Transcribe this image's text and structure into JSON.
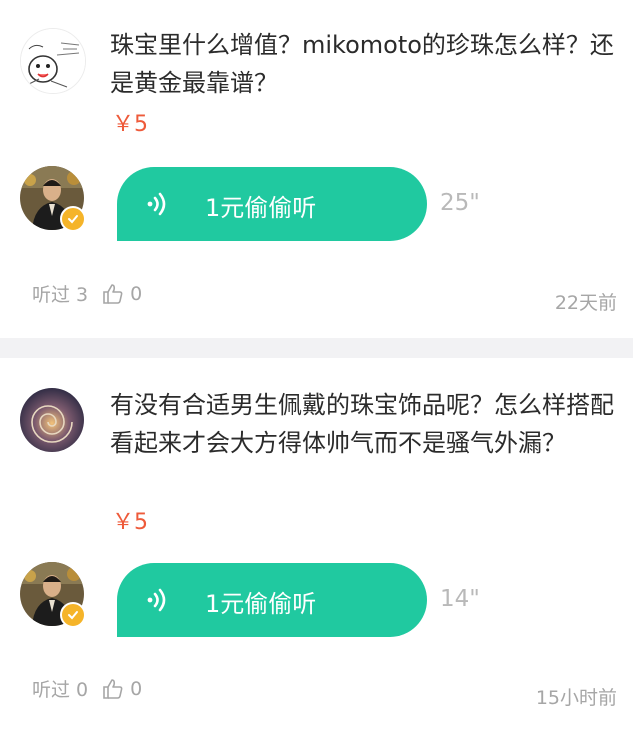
{
  "items": [
    {
      "question": "珠宝里什么增值？mikomoto的珍珠怎么样？还是黄金最靠谱？",
      "price": "￥5",
      "listen_label": "1元偷偷听",
      "duration": "25\"",
      "heard_label": "听过 3",
      "likes": "0",
      "time": "22天前"
    },
    {
      "question": "有没有合适男生佩戴的珠宝饰品呢？怎么样搭配看起来才会大方得体帅气而不是骚气外漏？",
      "price": "￥5",
      "listen_label": "1元偷偷听",
      "duration": "14\"",
      "heard_label": "听过 0",
      "likes": "0",
      "time": "15小时前"
    }
  ],
  "colors": {
    "accent_bubble": "#20c9a0",
    "price": "#ee5a3a",
    "badge": "#f5b429",
    "muted": "#a6a6a6",
    "divider": "#f2f2f4"
  },
  "icons": {
    "sound_wave": "sound-wave-icon",
    "thumbs_up": "thumbs-up-icon",
    "verified_badge": "verified-badge-icon"
  }
}
